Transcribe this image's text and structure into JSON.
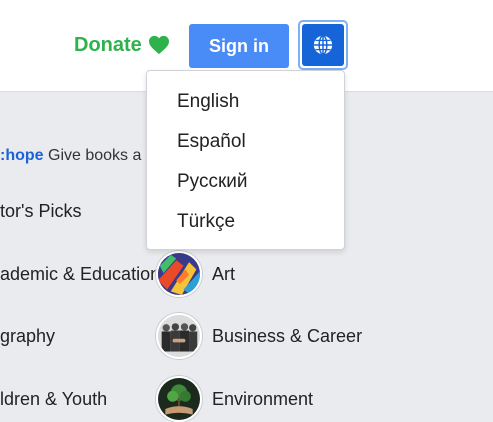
{
  "header": {
    "donate_label": "Donate",
    "signin_label": "Sign in",
    "language_icon": "globe-icon",
    "colors": {
      "donate": "#2eb24c",
      "signin_bg": "#4a8cf7",
      "lang_bg": "#1665d8"
    }
  },
  "promo": {
    "tag": ":hope",
    "text": " Give books a"
  },
  "categories": [
    {
      "label": "tor's Picks"
    },
    {
      "label": "ademic & Education"
    },
    {
      "label": "graphy"
    },
    {
      "label": "ldren & Youth"
    },
    {
      "label": "Art",
      "icon": "art-icon"
    },
    {
      "label": "Business & Career",
      "icon": "business-icon"
    },
    {
      "label": "Environment",
      "icon": "environment-icon"
    }
  ],
  "language_menu": {
    "items": [
      "English",
      "Español",
      "Русский",
      "Türkçe"
    ]
  }
}
